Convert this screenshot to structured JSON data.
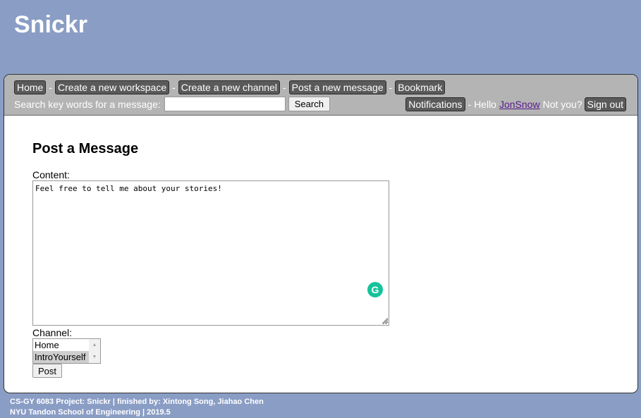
{
  "site": {
    "title": "Snickr"
  },
  "nav": {
    "items": [
      {
        "label": "Home"
      },
      {
        "label": "Create a new workspace"
      },
      {
        "label": "Create a new channel"
      },
      {
        "label": "Post a new message"
      },
      {
        "label": "Bookmark"
      }
    ],
    "separator": "-",
    "search": {
      "label": "Search key words for a message:",
      "value": "",
      "button": "Search"
    },
    "notifications_label": "Notifications",
    "greeting_prefix": "- Hello",
    "username": "JonSnow",
    "not_you_text": "Not you?",
    "sign_out_label": "Sign out"
  },
  "form": {
    "heading": "Post a Message",
    "content_label": "Content:",
    "content_value": "Feel free to tell me about your stories!",
    "channel_label": "Channel:",
    "channels": [
      {
        "label": "Home",
        "selected": false
      },
      {
        "label": "IntroYourself",
        "selected": true
      }
    ],
    "post_button": "Post"
  },
  "footer": {
    "line1": "CS-GY 6083 Project: Snickr | finished by: Xintong Song, Jiahao Chen",
    "line2": "NYU Tandon School of Engineering | 2019.5"
  },
  "icons": {
    "grammarly": "grammarly-icon",
    "scroll_up": "scroll-up-arrow-icon",
    "scroll_down": "scroll-down-arrow-icon"
  },
  "colors": {
    "page_background": "#8a9dc5",
    "navbar_background": "#b4b4b4",
    "nav_button": "#5a5a5a",
    "grammarly": "#15c39a",
    "visited_link": "#551a8b"
  }
}
